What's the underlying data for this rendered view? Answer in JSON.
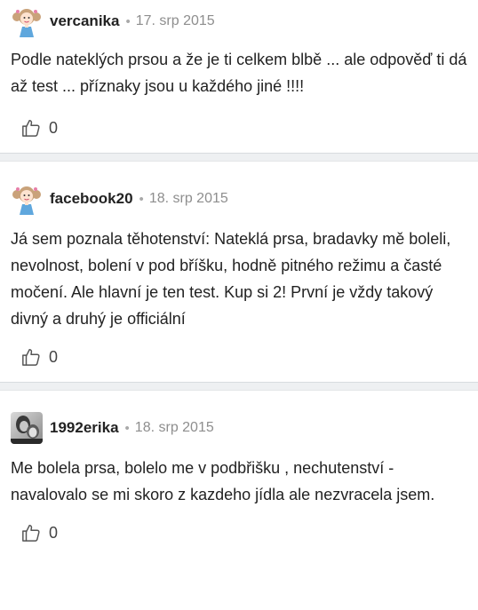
{
  "comments": [
    {
      "username": "vercanika",
      "date": "17. srp 2015",
      "avatar_icon": "cartoon-girl-avatar-icon",
      "text": "Podle nateklých prsou a že je ti celkem blbě ... ale odpověď ti dá až test ... příznaky jsou u každého jiné !!!!",
      "likes": "0"
    },
    {
      "username": "facebook20",
      "date": "18. srp 2015",
      "avatar_icon": "cartoon-girl-avatar-icon",
      "text": "Já sem poznala těhotenství: Nateklá prsa, bradavky mě boleli, nevolnost, bolení v pod bříšku, hodně pitného režimu a časté močení. Ale hlavní je ten test. Kup si 2! První je vždy takový divný a druhý je officiální",
      "likes": "0"
    },
    {
      "username": "1992erika",
      "date": "18. srp 2015",
      "avatar_icon": "photo-avatar-icon",
      "text": "Me bolela prsa, bolelo me v podbřišku , nechutenství - navalovalo se mi skoro z kazdeho jídla ale nezvracela jsem.",
      "likes": "0"
    }
  ],
  "separator": "•",
  "like_icon": "thumbs-up-icon",
  "colors": {
    "divider_bg": "#eef0f2",
    "date_text": "#8e8e8e",
    "avatar_pink": "#e77fa8",
    "avatar_hair": "#c9a27a",
    "avatar_blue": "#5fa7dd"
  }
}
